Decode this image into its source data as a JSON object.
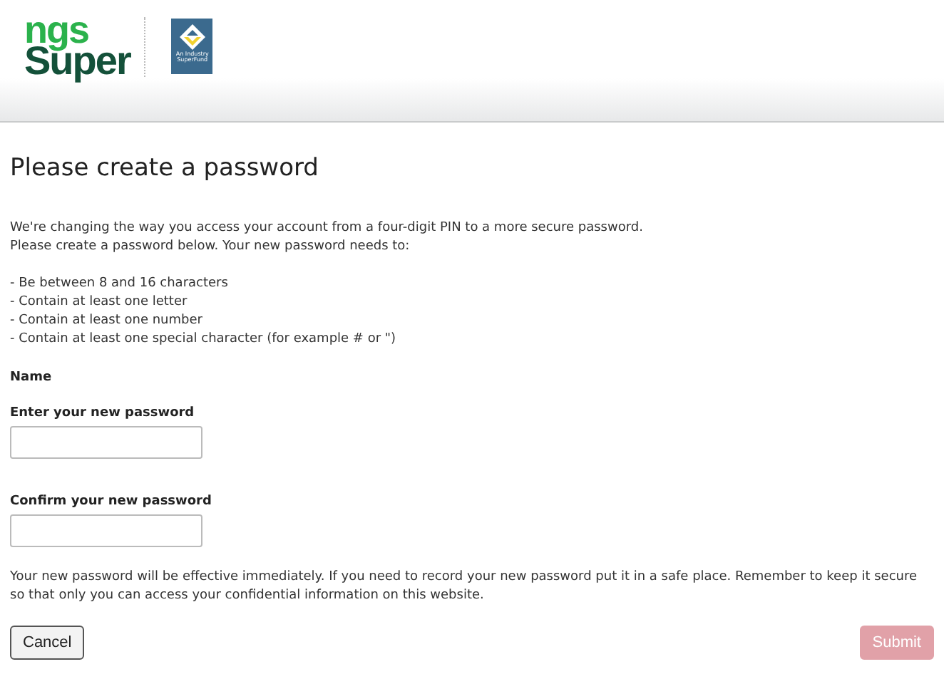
{
  "logo": {
    "wordmark_top": "ngs",
    "wordmark_bottom": "Super",
    "badge": "An Industry SuperFund"
  },
  "title": "Please create a password",
  "intro": [
    "We're changing the way you access your account from a four-digit PIN to a more secure password.",
    "Please create a password below. Your new password needs to:"
  ],
  "requirements": [
    "- Be between 8 and 16 characters",
    "- Contain at least one letter",
    "- Contain at least one number",
    "- Contain at least one special character (for example # or \")"
  ],
  "name_label": "Name",
  "fields": [
    {
      "label": "Enter your new password"
    },
    {
      "label": "Confirm your new password"
    }
  ],
  "notice": "Your new password will be effective immediately. If you need to record your new password put it in a safe place. Remember to keep it secure so that only you can access your confidential information on this website.",
  "buttons": [
    {
      "label": "Cancel",
      "kind": "secondary",
      "disabled": false
    },
    {
      "label": "Submit",
      "kind": "primary",
      "disabled": true
    }
  ]
}
